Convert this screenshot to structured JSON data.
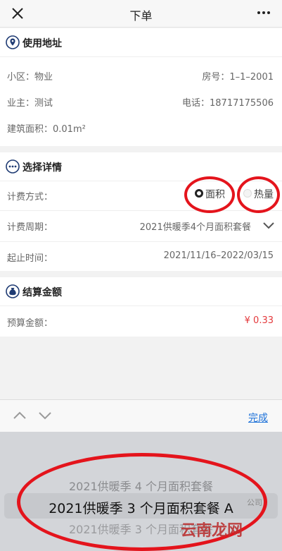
{
  "nav": {
    "title": "下单",
    "close_icon": "close-icon",
    "more_icon": "more-icon"
  },
  "address": {
    "header": "使用地址",
    "community": "小区：物业",
    "room": "房号：1–1–2001",
    "owner": "业主：测试",
    "phone": "电话：18717175506",
    "area": "建筑面积：0.01m²"
  },
  "details": {
    "header": "选择详情",
    "billing_method_label": "计费方式：",
    "option_area": "面积",
    "option_heat": "热量",
    "selected_option": "面积",
    "billing_cycle_label": "计费周期：",
    "billing_cycle_value": "2021供暖季4个月面积套餐",
    "period_label": "起止时间：",
    "period_value": "2021/11/16–2022/03/15"
  },
  "settlement": {
    "header": "结算金额",
    "budget_label": "预算金额：",
    "budget_value": "¥ 0.33"
  },
  "toolbar": {
    "done_label": "完成"
  },
  "picker": {
    "options": [
      "2021供暖季 4 个月面积套餐",
      "2021供暖季 3 个月面积套餐 A",
      "2021供暖季 3 个月面积套餐"
    ],
    "selected_index": 1
  },
  "watermark": {
    "brand": "云南龙网",
    "small": "公司"
  },
  "colors": {
    "accent_blue": "#1a6fd8",
    "price_red": "#e4393c",
    "annotation_red": "#e4141c",
    "icon_blue": "#1f3b73"
  }
}
